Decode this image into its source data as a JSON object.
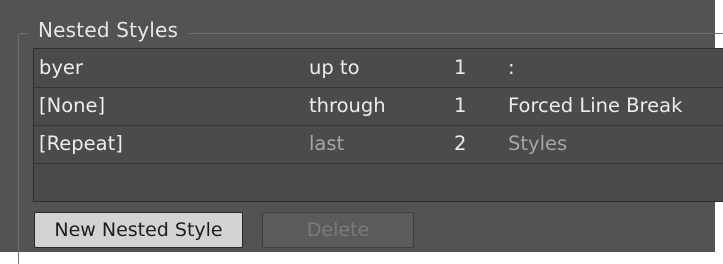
{
  "panel": {
    "title": "Nested Styles"
  },
  "rows": [
    {
      "style": "byer",
      "mode": "up to",
      "count": "1",
      "delimiter": ":"
    },
    {
      "style": "[None]",
      "mode": "through",
      "count": "1",
      "delimiter": "Forced Line Break"
    },
    {
      "style": "[Repeat]",
      "mode": "last",
      "count": "2",
      "delimiter": "Styles"
    }
  ],
  "buttons": {
    "new_label": "New Nested Style",
    "delete_label": "Delete"
  },
  "colors": {
    "panel_bg": "#535353",
    "table_bg": "#4b4b4b",
    "text": "#ececec",
    "text_dim": "#a5a5a5",
    "button_bg": "#d3d3d3"
  }
}
